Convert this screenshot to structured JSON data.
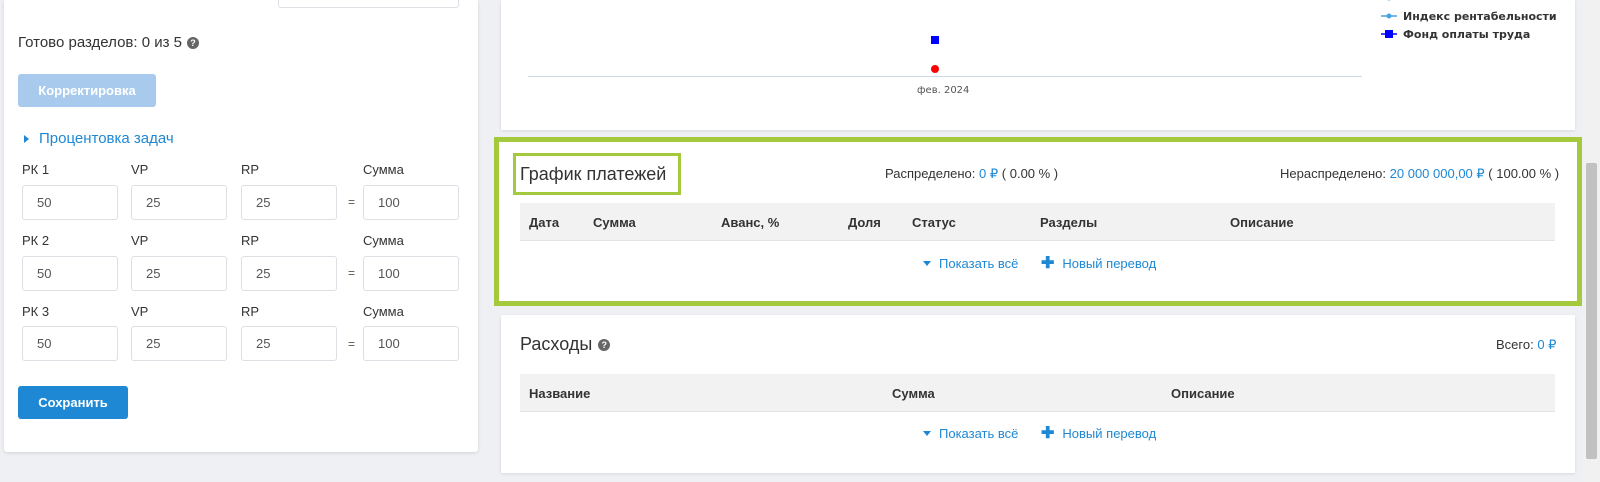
{
  "left": {
    "ready_text": "Готово разделов: 0 из 5",
    "help_icon": "?",
    "correct_button": "Корректировка",
    "percent_toggle": "Процентовка задач",
    "rows": [
      {
        "label": "РК 1",
        "vp_label": "VP",
        "rp_label": "RP",
        "sum_label": "Сумма",
        "rk": "50",
        "vp": "25",
        "rp": "25",
        "eq": "=",
        "sum": "100"
      },
      {
        "label": "РК 2",
        "vp_label": "VP",
        "rp_label": "RP",
        "sum_label": "Сумма",
        "rk": "50",
        "vp": "25",
        "rp": "25",
        "eq": "=",
        "sum": "100"
      },
      {
        "label": "РК 3",
        "vp_label": "VP",
        "rp_label": "RP",
        "sum_label": "Сумма",
        "rk": "50",
        "vp": "25",
        "rp": "25",
        "eq": "=",
        "sum": "100"
      }
    ],
    "save_button": "Сохранить"
  },
  "chart": {
    "x_tick": "фев. 2024",
    "legend": [
      {
        "name": "Индекс рентабельности",
        "color": "#4aa3df",
        "marker": "line-dot"
      },
      {
        "name": "Фонд оплаты труда",
        "color": "#0000ff",
        "marker": "square"
      }
    ],
    "points": [
      {
        "series": "Фонд оплаты труда",
        "color": "#0000ff",
        "shape": "square"
      },
      {
        "series": "",
        "color": "#ff0000",
        "shape": "circle"
      }
    ]
  },
  "payments": {
    "title": "График платежей",
    "distributed_label": "Распределено:",
    "distributed_value": "0 ₽",
    "distributed_pct": "( 0.00 % )",
    "undistributed_label": "Нераспределено:",
    "undistributed_value": "20 000 000,00 ₽",
    "undistributed_pct": "( 100.00 % )",
    "columns": [
      "Дата",
      "Сумма",
      "Аванс, %",
      "Доля",
      "Статус",
      "Разделы",
      "Описание"
    ],
    "show_all": "Показать всё",
    "new_transfer": "Новый перевод"
  },
  "expenses": {
    "title": "Расходы",
    "help_icon": "?",
    "total_label": "Всего:",
    "total_value": "0 ₽",
    "columns": [
      "Название",
      "Сумма",
      "Описание"
    ],
    "show_all": "Показать всё",
    "new_transfer": "Новый перевод"
  },
  "colors": {
    "accent": "#1e88d4",
    "highlight": "#a5c93d",
    "disabled_button": "#a8cbed"
  }
}
